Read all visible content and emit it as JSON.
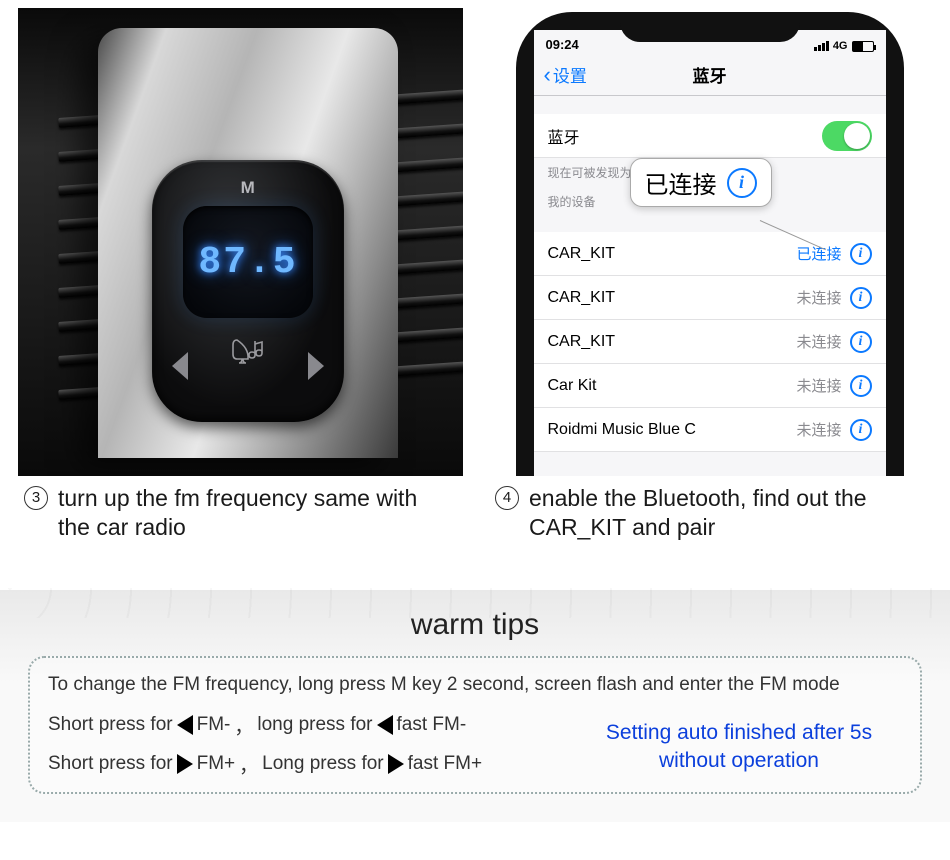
{
  "device": {
    "m_label": "M",
    "frequency": "87.5"
  },
  "phone": {
    "status_time": "09:24",
    "status_net": "4G",
    "nav_back": "设置",
    "nav_title": "蓝牙",
    "bt_label": "蓝牙",
    "discover_note": "现在可被发现为\"",
    "my_devices_head": "我的设备",
    "callout_text": "已连接",
    "devices": [
      {
        "name": "CAR_KIT",
        "status": "已连接",
        "connected": true
      },
      {
        "name": "CAR_KIT",
        "status": "未连接",
        "connected": false
      },
      {
        "name": "CAR_KIT",
        "status": "未连接",
        "connected": false
      },
      {
        "name": "Car Kit",
        "status": "未连接",
        "connected": false
      },
      {
        "name": "Roidmi Music Blue C",
        "status": "未连接",
        "connected": false
      }
    ]
  },
  "captions": {
    "c3_num": "3",
    "c3_text": "turn up the fm frequency same with the car radio",
    "c4_num": "4",
    "c4_text": "enable the Bluetooth, find out the CAR_KIT and pair"
  },
  "tips": {
    "title": "warm tips",
    "line1": "To change the FM frequency, long press M key 2 second, screen flash and enter the FM mode",
    "short_press": "Short press for",
    "long_press_lc": "long press for",
    "long_press_uc": "Long press for",
    "fm_minus": "FM-",
    "fast_fm_minus": "fast FM-",
    "fm_plus": "FM+",
    "fast_fm_plus": "fast FM+",
    "comma": "，",
    "blue_note": "Setting auto finished after 5s without operation"
  }
}
